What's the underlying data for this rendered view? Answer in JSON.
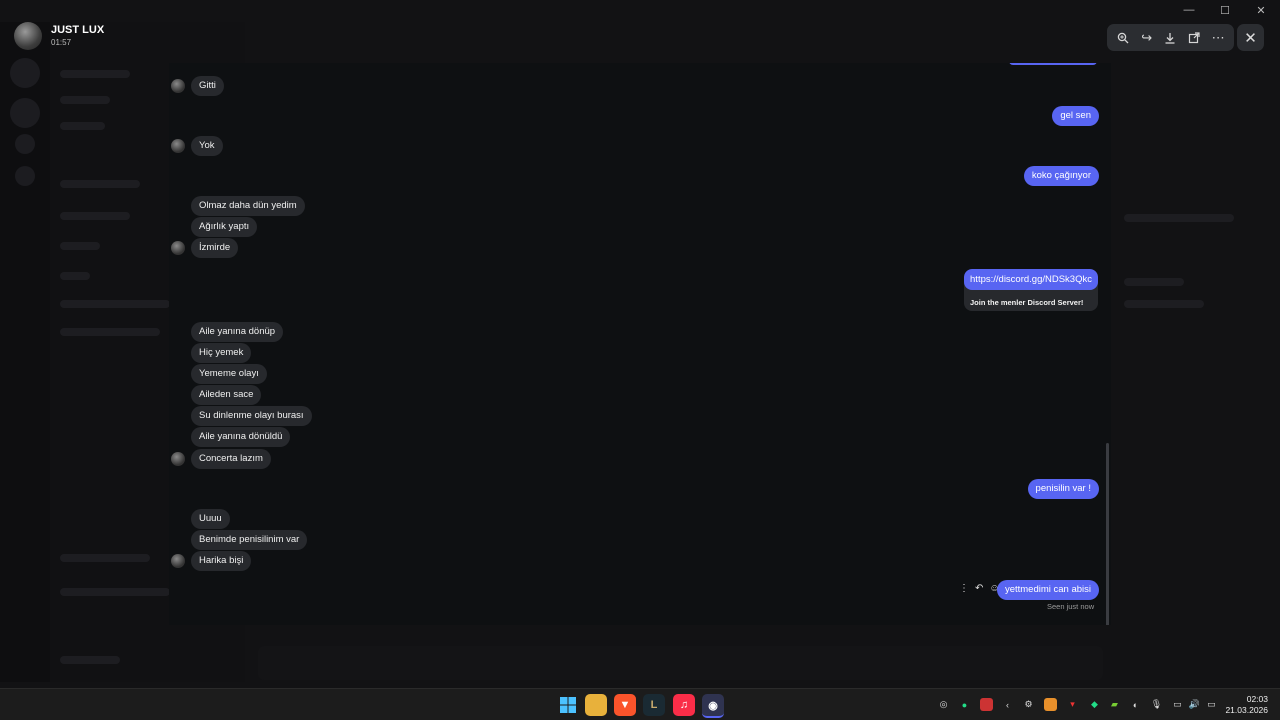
{
  "viewer": {
    "user_name": "JUST LUX",
    "timestamp": "01:57"
  },
  "toolbar_icons": [
    "zoom-in-icon",
    "forward-icon",
    "download-icon",
    "open-external-icon",
    "more-icon"
  ],
  "messages": {
    "gitti": "Gitti",
    "gel_sen": "gel sen",
    "yok": "Yok",
    "koko": "koko çağınyor",
    "olmaz": "Olmaz daha dün yedim",
    "agirlik": "Ağırlık yaptı",
    "izmirde": "İzmirde",
    "link": "https://discord.gg/NDSk3Qkc",
    "embed_title": "Join the menler Discord Server!",
    "aile1": "Aile yanına dönüp",
    "hic": "Hiç yemek",
    "yememe": "Yememe olayı",
    "aileden": "Aileden sace",
    "su": "Su dinlenme olayı burası",
    "aile2": "Aile yanına dönüldü",
    "concerta": "Concerta lazım",
    "penisilin": "penisilin var !",
    "uuuu": "Uuuu",
    "benimde": "Benimde penisilinim var",
    "harika": "Harika bişi",
    "yettmedimi": "yettmedimi can abisi",
    "seen": "Seen just now"
  },
  "taskbar": {
    "apps": [
      "start-icon",
      "file-explorer-icon",
      "brave-icon",
      "league-icon",
      "music-icon",
      "discord-icon"
    ],
    "time": "02:03",
    "date": "21.03.2026"
  },
  "colors": {
    "accent": "#5865f2",
    "bubble_left": "#27292d",
    "panel_bg": "#0e1012"
  }
}
